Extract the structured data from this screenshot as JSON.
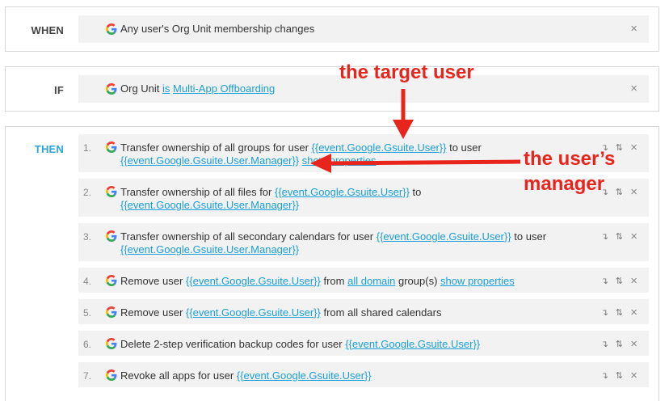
{
  "when": {
    "label": "WHEN",
    "text": "Any user's Org Unit membership changes",
    "close": "×"
  },
  "if": {
    "label": "IF",
    "prefix": "Org Unit ",
    "is_word": "is",
    "value": "Multi-App Offboarding",
    "close": "×"
  },
  "then": {
    "label": "THEN",
    "steps": [
      {
        "num": "1.",
        "a": "Transfer ownership of all groups for user ",
        "link1": "{{event.Google.Gsuite.User}}",
        "b": " to user ",
        "link2": "{{event.Google.Gsuite.User.Manager}}",
        "c": " ",
        "link3": "show properties"
      },
      {
        "num": "2.",
        "a": "Transfer ownership of all files for ",
        "link1": "{{event.Google.Gsuite.User}}",
        "b": " to ",
        "link2": "{{event.Google.Gsuite.User.Manager}}"
      },
      {
        "num": "3.",
        "a": "Transfer ownership of all secondary calendars for user ",
        "link1": "{{event.Google.Gsuite.User}}",
        "b": " to user ",
        "link2": "{{event.Google.Gsuite.User.Manager}}"
      },
      {
        "num": "4.",
        "a": "Remove user ",
        "link1": "{{event.Google.Gsuite.User}}",
        "b": " from ",
        "link2": "all domain",
        "c": " group(s) ",
        "link3": "show properties"
      },
      {
        "num": "5.",
        "a": "Remove user ",
        "link1": "{{event.Google.Gsuite.User}}",
        "b": " from all shared calendars"
      },
      {
        "num": "6.",
        "a": "Delete 2-step verification backup codes for user ",
        "link1": "{{event.Google.Gsuite.User}}"
      },
      {
        "num": "7.",
        "a": "Revoke all apps for user ",
        "link1": "{{event.Google.Gsuite.User}}"
      }
    ],
    "close": "×",
    "skip_glyph": "↴",
    "move_glyph": "⇅"
  },
  "annotations": {
    "target": "the target user",
    "manager_line1": "the user’s",
    "manager_line2": "manager"
  },
  "colors": {
    "accent": "#2aa6d8",
    "link": "#1a9fd9",
    "annotation": "#e8251d",
    "row_bg": "#f2f2f2"
  }
}
